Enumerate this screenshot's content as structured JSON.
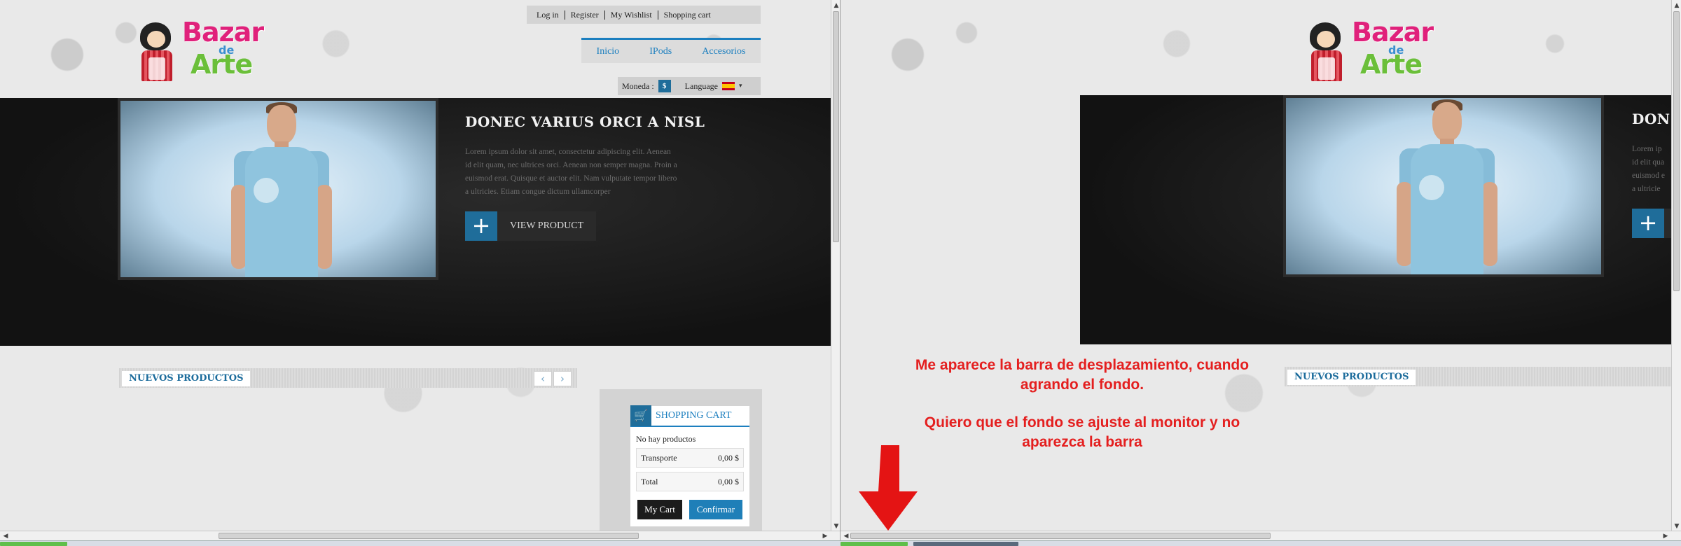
{
  "site": {
    "top_links": [
      "Log in",
      "Register",
      "My Wishlist",
      "Shopping cart"
    ],
    "logo": {
      "line1": "Bazar",
      "line2": "de",
      "line3": "Arte"
    },
    "nav": [
      "Inicio",
      "IPods",
      "Accesorios"
    ],
    "currency_label": "Moneda :",
    "currency_symbol": "$",
    "language_label": "Language"
  },
  "hero": {
    "title": "DONEC VARIUS ORCI A NISL",
    "title_clipped": "DON",
    "text_lines": [
      "Lorem ipsum dolor sit amet, consectetur adipiscing elit. Aenean",
      "id elit quam, nec ultrices orci. Aenean non semper magna. Proin a",
      "euismod erat. Quisque et auctor elit. Nam vulputate tempor libero",
      "a ultricies. Etiam congue dictum ullamcorper"
    ],
    "text_clipped": [
      "Lorem ip",
      "id elit qua",
      "euismod e",
      "a ultricie"
    ],
    "button_label": "VIEW PRODUCT",
    "button_icon": "+"
  },
  "products": {
    "section_title": "NUEVOS PRODUCTOS",
    "prev_icon": "‹",
    "next_icon": "›"
  },
  "cart": {
    "title": "SHOPPING CART",
    "empty_text": "No hay productos",
    "shipping_label": "Transporte",
    "shipping_value": "0,00 $",
    "total_label": "Total",
    "total_value": "0,00 $",
    "my_cart_button": "My Cart",
    "confirm_button": "Confirmar"
  },
  "annotation": {
    "line1": "Me aparece la barra de desplazamiento, cuando",
    "line2": "agrando el fondo.",
    "line3": "Quiero que el fondo se ajuste al monitor y no",
    "line4": "aparezca la barra"
  },
  "colors": {
    "accent_blue": "#1c7fbf",
    "dark_blue": "#1f6d9a",
    "logo_pink": "#e0217b",
    "logo_green": "#6bbf3a",
    "annotation_red": "#e41f1f",
    "hero_bg": "#1a1a1a"
  }
}
